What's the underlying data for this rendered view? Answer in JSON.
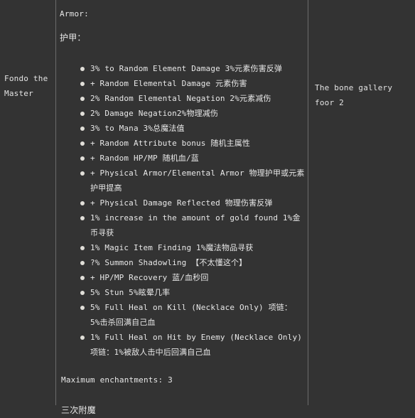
{
  "left_panel": {
    "label": "Fondo the Master"
  },
  "right_panel": {
    "label": "The bone gallery foor 2"
  },
  "center_panel": {
    "heading_en": "Armor:",
    "heading_zh": "护甲：",
    "enchantments": [
      "3% to Random Element Damage 3%元素伤害反弹",
      "+ Random Elemental Damage 元素伤害",
      "2% Random Elemental Negation 2%元素减伤",
      "2% Damage Negation2%物理减伤",
      "3% to Mana 3%总魔法值",
      "+ Random Attribute bonus 随机主属性",
      "+ Random HP/MP 随机血/蓝",
      "+ Physical Armor/Elemental Armor 物理护甲或元素护甲提高",
      "+ Physical Damage Reflected 物理伤害反弹",
      "1% increase in the amount of gold found 1%金币寻获",
      "1% Magic Item Finding 1%魔法物品寻获",
      "?% Summon Shadowling 【不太懂这个】",
      "+ HP/MP Recovery 蓝/血秒回",
      "5% Stun 5%眩晕几率",
      "5% Full Heal on Kill (Necklace Only) 项链： 5%击杀回满自己血",
      "1% Full Heal on Hit by Enemy (Necklace Only) 项链：1%被敌人击中后回满自己血"
    ],
    "footer_en": "Maximum enchantments: 3",
    "footer_zh": "三次附魔"
  },
  "colors": {
    "background": "#333333",
    "text": "#e8e8e8",
    "divider": "#6b6b6b",
    "bullet": "#e0ded8"
  }
}
